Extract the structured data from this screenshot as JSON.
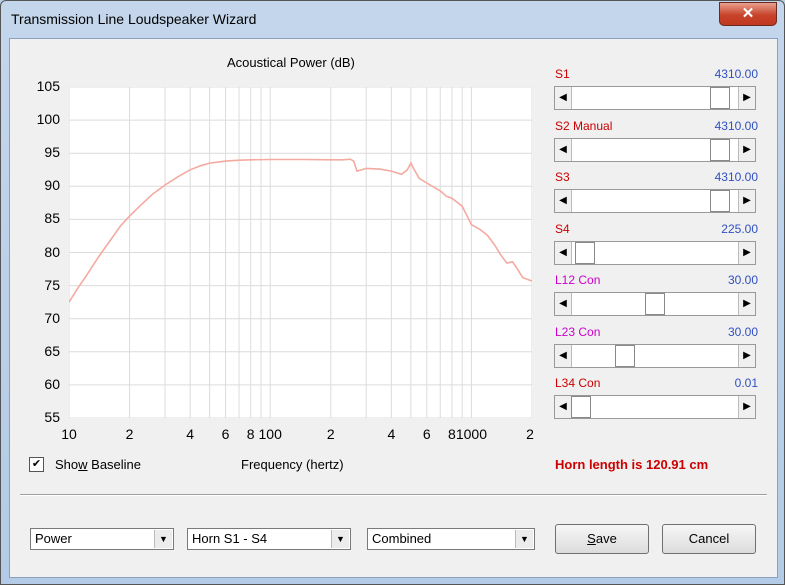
{
  "window": {
    "title": "Transmission Line Loudspeaker Wizard",
    "close_glyph": "✕"
  },
  "chart_data": {
    "type": "line",
    "title": "Acoustical Power (dB)",
    "xlabel": "Frequency (hertz)",
    "ylabel": "",
    "x_scale": "log",
    "xlim": [
      10,
      2000
    ],
    "ylim": [
      55,
      105
    ],
    "y_ticks": [
      "105",
      "100",
      "95",
      "90",
      "85",
      "80",
      "75",
      "70",
      "65",
      "60",
      "55"
    ],
    "x_ticks": [
      "10",
      "2",
      "4",
      "6",
      "8",
      "100",
      "2",
      "4",
      "6",
      "8",
      "1000",
      "2"
    ],
    "grid": true,
    "line_color": "#f4aaa0",
    "series": [
      {
        "x": [
          10,
          11,
          12.5,
          14,
          16,
          18,
          20,
          23,
          26,
          30,
          35,
          40,
          45,
          50,
          60,
          70,
          80,
          100,
          120,
          150,
          200,
          230,
          250,
          260,
          270,
          300,
          350,
          400,
          450,
          480,
          500,
          520,
          550,
          600,
          700,
          750,
          800,
          900,
          1000,
          1100,
          1200,
          1300,
          1400,
          1500,
          1600,
          1700,
          1800,
          2000
        ],
        "y": [
          72.5,
          74.5,
          77,
          79.3,
          81.8,
          84,
          85.5,
          87.3,
          88.8,
          90.2,
          91.5,
          92.5,
          93.1,
          93.5,
          93.8,
          93.95,
          94.0,
          94.05,
          94.05,
          94.05,
          94.0,
          94.0,
          94.1,
          93.8,
          92.3,
          92.7,
          92.6,
          92.3,
          91.8,
          92.5,
          93.5,
          92.5,
          91.2,
          90.5,
          89.3,
          88.5,
          88.2,
          87.0,
          84.2,
          83.5,
          82.6,
          81.2,
          79.6,
          78.4,
          78.6,
          77.4,
          76.2,
          75.7
        ]
      }
    ]
  },
  "checkbox": {
    "label_pre": "Sho",
    "label_u": "w",
    "label_post": " Baseline",
    "checked": true,
    "mark": "✔"
  },
  "sliders": [
    {
      "label": "S1",
      "value": "4310.00",
      "color": "#cc0000",
      "pos": 0.94
    },
    {
      "label": "S2  Manual",
      "value": "4310.00",
      "color": "#cc0000",
      "pos": 0.94
    },
    {
      "label": "S3",
      "value": "4310.00",
      "color": "#cc0000",
      "pos": 0.94
    },
    {
      "label": "S4",
      "value": "225.00",
      "color": "#cc0000",
      "pos": 0.03
    },
    {
      "label": "L12  Con",
      "value": "30.00",
      "color": "#cc00cc",
      "pos": 0.5
    },
    {
      "label": "L23  Con",
      "value": "30.00",
      "color": "#cc00cc",
      "pos": 0.3
    },
    {
      "label": "L34  Con",
      "value": "0.01",
      "color": "#cc0000",
      "pos": 0.0
    }
  ],
  "arrows": {
    "left": "◀",
    "right": "▶",
    "down": "▼"
  },
  "horn_length": "Horn length is 120.91 cm",
  "combos": [
    {
      "value": "Power"
    },
    {
      "value": "Horn S1 - S4"
    },
    {
      "value": "Combined"
    }
  ],
  "buttons": {
    "save_u": "S",
    "save_rest": "ave",
    "cancel": "Cancel"
  }
}
